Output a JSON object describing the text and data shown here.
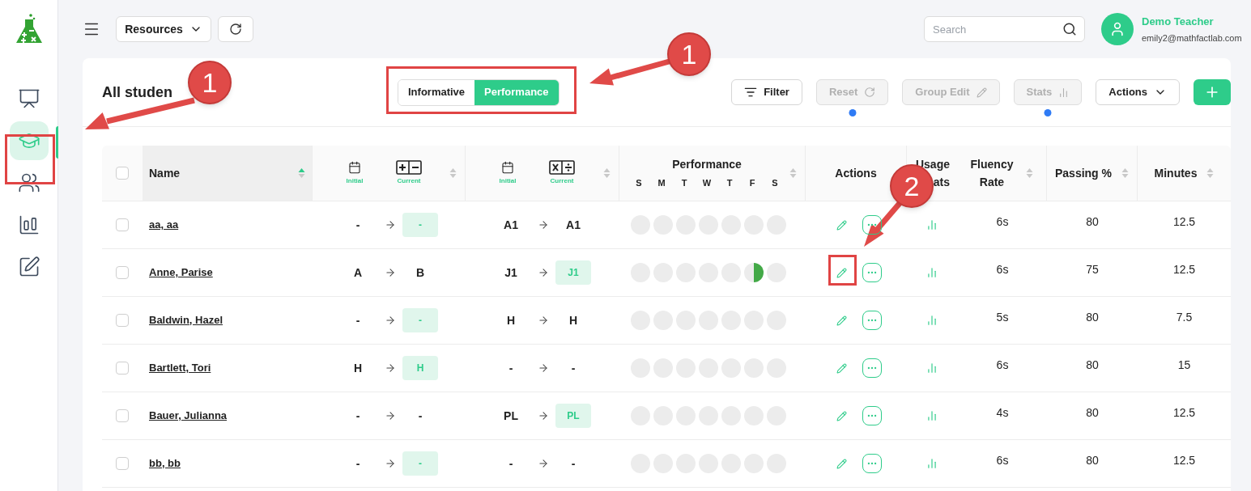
{
  "sidebar": {
    "items": [
      {
        "kind": "classroom",
        "selected": false
      },
      {
        "kind": "students",
        "selected": true
      },
      {
        "kind": "teaching",
        "selected": false
      },
      {
        "kind": "reports",
        "selected": false
      },
      {
        "kind": "edit",
        "selected": false
      }
    ]
  },
  "topbar": {
    "resources": "Resources",
    "search": {
      "placeholder": "Search"
    },
    "user": {
      "name": "Demo Teacher",
      "email": "emily2@mathfactlab.com"
    }
  },
  "card": {
    "title": "All studen",
    "view_toggle": [
      {
        "label": "Informative",
        "selected": false
      },
      {
        "label": "Performance",
        "selected": true
      }
    ],
    "toolbar": [
      {
        "kind": "filter",
        "label": "Filter",
        "disabled": false,
        "indicator": false
      },
      {
        "kind": "reset",
        "label": "Reset",
        "disabled": true,
        "indicator": true
      },
      {
        "kind": "edit",
        "label": "Group Edit",
        "disabled": true,
        "indicator": false
      },
      {
        "kind": "stats",
        "label": "Stats",
        "disabled": true,
        "indicator": true
      },
      {
        "kind": "menu",
        "label": "Actions",
        "disabled": false,
        "indicator": false
      },
      {
        "kind": "add"
      }
    ]
  },
  "table": {
    "columns": [
      {
        "kind": "check",
        "checked": false
      },
      {
        "kind": "text",
        "label": "Name",
        "sorted": true
      },
      {
        "kind": "addsub",
        "initial_label": "Initial",
        "current_label": "Current",
        "sorted": false
      },
      {
        "kind": "muldiv",
        "initial_label": "Initial",
        "current_label": "Current",
        "sorted": false
      },
      {
        "kind": "week",
        "label": "Performance",
        "days": [
          "S",
          "M",
          "T",
          "W",
          "T",
          "F",
          "S"
        ],
        "sorted": false
      },
      {
        "kind": "text",
        "label": "Actions"
      },
      {
        "kind": "partial",
        "lines": [
          "Usage",
          "ats"
        ]
      },
      {
        "kind": "stacked",
        "lines": [
          "Fluency",
          "Rate"
        ],
        "sorted": false
      },
      {
        "kind": "text",
        "label": "Passing %",
        "sorted": false
      },
      {
        "kind": "text",
        "label": "Minutes",
        "sorted": false
      }
    ],
    "rows": [
      {
        "name": "aa, aa",
        "checked": false,
        "addsub": {
          "initial": "-",
          "current": "-",
          "highlighted": true
        },
        "muldiv": {
          "initial": "A1",
          "current": "A1",
          "highlighted": false
        },
        "week": [
          {
            "half_filled": false
          },
          {
            "half_filled": false
          },
          {
            "half_filled": false
          },
          {
            "half_filled": false
          },
          {
            "half_filled": false
          },
          {
            "half_filled": false
          },
          {
            "half_filled": false
          }
        ],
        "fluency": "6s",
        "passing": "80",
        "minutes": "12.5"
      },
      {
        "name": "Anne, Parise",
        "checked": false,
        "addsub": {
          "initial": "A",
          "current": "B",
          "highlighted": false
        },
        "muldiv": {
          "initial": "J1",
          "current": "J1",
          "highlighted": true
        },
        "week": [
          {
            "half_filled": false
          },
          {
            "half_filled": false
          },
          {
            "half_filled": false
          },
          {
            "half_filled": false
          },
          {
            "half_filled": false
          },
          {
            "half_filled": true
          },
          {
            "half_filled": false
          }
        ],
        "fluency": "6s",
        "passing": "75",
        "minutes": "12.5"
      },
      {
        "name": "Baldwin, Hazel",
        "checked": false,
        "addsub": {
          "initial": "-",
          "current": "-",
          "highlighted": true
        },
        "muldiv": {
          "initial": "H",
          "current": "H",
          "highlighted": false
        },
        "week": [
          {
            "half_filled": false
          },
          {
            "half_filled": false
          },
          {
            "half_filled": false
          },
          {
            "half_filled": false
          },
          {
            "half_filled": false
          },
          {
            "half_filled": false
          },
          {
            "half_filled": false
          }
        ],
        "fluency": "5s",
        "passing": "80",
        "minutes": "7.5"
      },
      {
        "name": "Bartlett, Tori",
        "checked": false,
        "addsub": {
          "initial": "H",
          "current": "H",
          "highlighted": true
        },
        "muldiv": {
          "initial": "-",
          "current": "-",
          "highlighted": false
        },
        "week": [
          {
            "half_filled": false
          },
          {
            "half_filled": false
          },
          {
            "half_filled": false
          },
          {
            "half_filled": false
          },
          {
            "half_filled": false
          },
          {
            "half_filled": false
          },
          {
            "half_filled": false
          }
        ],
        "fluency": "6s",
        "passing": "80",
        "minutes": "15"
      },
      {
        "name": "Bauer, Julianna",
        "checked": false,
        "addsub": {
          "initial": "-",
          "current": "-",
          "highlighted": false
        },
        "muldiv": {
          "initial": "PL",
          "current": "PL",
          "highlighted": true
        },
        "week": [
          {
            "half_filled": false
          },
          {
            "half_filled": false
          },
          {
            "half_filled": false
          },
          {
            "half_filled": false
          },
          {
            "half_filled": false
          },
          {
            "half_filled": false
          },
          {
            "half_filled": false
          }
        ],
        "fluency": "4s",
        "passing": "80",
        "minutes": "12.5"
      },
      {
        "name": "bb, bb",
        "checked": false,
        "addsub": {
          "initial": "-",
          "current": "-",
          "highlighted": true
        },
        "muldiv": {
          "initial": "-",
          "current": "-",
          "highlighted": false
        },
        "week": [
          {
            "half_filled": false
          },
          {
            "half_filled": false
          },
          {
            "half_filled": false
          },
          {
            "half_filled": false
          },
          {
            "half_filled": false
          },
          {
            "half_filled": false
          },
          {
            "half_filled": false
          }
        ],
        "fluency": "6s",
        "passing": "80",
        "minutes": "12.5"
      }
    ]
  },
  "annotations": [
    {
      "label": "1"
    },
    {
      "label": "1"
    },
    {
      "label": "2"
    }
  ]
}
